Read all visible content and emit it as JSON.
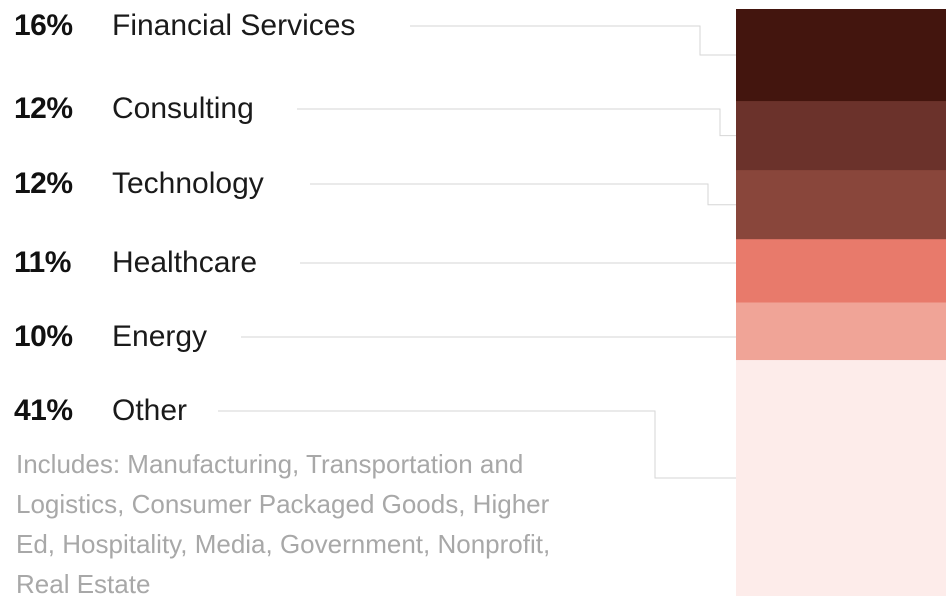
{
  "chart_data": {
    "type": "bar",
    "stacked": true,
    "orientation": "vertical",
    "categories": [
      "Financial Services",
      "Consulting",
      "Technology",
      "Healthcare",
      "Energy",
      "Other"
    ],
    "values": [
      16,
      12,
      12,
      11,
      10,
      41
    ],
    "labels": [
      "16%",
      "12%",
      "12%",
      "11%",
      "10%",
      "41%"
    ],
    "colors": [
      "#43150e",
      "#6b322b",
      "#89463b",
      "#e87a6b",
      "#f0a497",
      "#fdecea"
    ],
    "note": "Includes: Manufacturing, Transportation and Logistics, Consumer Packaged Goods, Higher Ed, Hospitality, Media, Government, Nonprofit, Real Estate",
    "grid": false
  }
}
